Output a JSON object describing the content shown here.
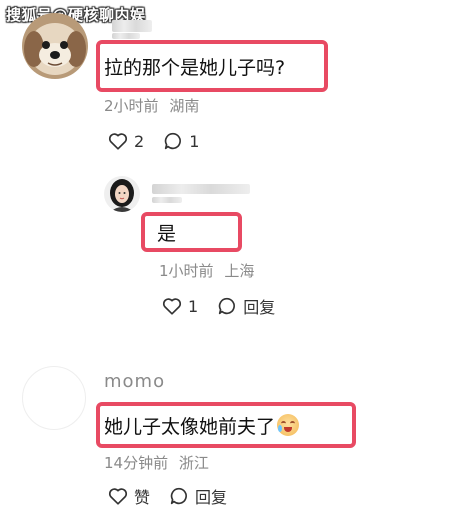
{
  "watermark": "搜狐号@硬核聊内娱",
  "comments": [
    {
      "text": "拉的那个是她儿子吗?",
      "time": "2小时前",
      "location": "湖南",
      "likes": "2",
      "replies": "1"
    },
    {
      "text": "是",
      "time": "1小时前",
      "location": "上海",
      "likes": "1",
      "reply_label": "回复"
    },
    {
      "username": "momo",
      "text": "她儿子太像她前夫了",
      "time": "14分钟前",
      "location": "浙江",
      "like_label": "赞",
      "reply_label": "回复"
    }
  ],
  "colors": {
    "highlight": "#e84a63",
    "meta": "#8a8a8a"
  },
  "icons": [
    "dog-avatar",
    "woman-avatar",
    "blank-avatar",
    "heart-icon",
    "comment-bubble-icon",
    "crying-emoji-icon"
  ]
}
